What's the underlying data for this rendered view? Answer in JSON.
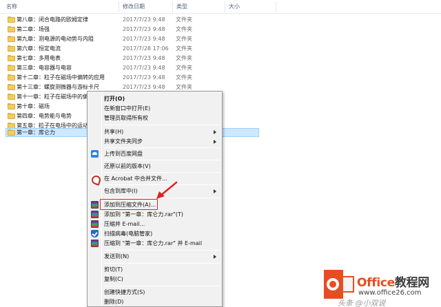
{
  "columns": {
    "name": "名称",
    "date": "修改日期",
    "type": "类型",
    "size": "大小"
  },
  "files": [
    {
      "name": "第八章：闭合电路的欧姆定律",
      "date": "2017/7/23 9:48",
      "type": "文件夹"
    },
    {
      "name": "第二章：场强",
      "date": "2017/7/23 9:48",
      "type": "文件夹"
    },
    {
      "name": "第九章：测电源的电动势与内阻",
      "date": "2017/7/23 9:48",
      "type": "文件夹"
    },
    {
      "name": "第六章：恒定电流",
      "date": "2017/7/28 17:06",
      "type": "文件夹"
    },
    {
      "name": "第七章：多用电表",
      "date": "2017/7/23 9:48",
      "type": "文件夹"
    },
    {
      "name": "第三章：电容器与电容",
      "date": "2017/7/23 9:48",
      "type": "文件夹"
    },
    {
      "name": "第十二章：粒子在磁场中偏转的应用",
      "date": "2017/7/23 9:48",
      "type": "文件夹"
    },
    {
      "name": "第十三章：螺旋测微器与游标卡尺",
      "date": "2017/7/23 9:48",
      "type": "文件夹"
    },
    {
      "name": "第十一章：粒子在磁场中的偏转",
      "date": "",
      "type": ""
    },
    {
      "name": "第十章：磁场",
      "date": "",
      "type": ""
    },
    {
      "name": "第四章：电势能与电势",
      "date": "",
      "type": ""
    },
    {
      "name": "第五章：粒子在电场中的运动",
      "date": "",
      "type": ""
    },
    {
      "name": "第一章：库仑力",
      "date": "",
      "type": ""
    }
  ],
  "menu": {
    "open": "打开(O)",
    "open_new_window": "在新窗口中打开(E)",
    "admin_ownership": "管理员取得所有权",
    "share": "共享(H)",
    "share_sync": "共享文件夹同步",
    "upload_baidu": "上传到百度网盘",
    "restore_previous": "还原以前的版本(V)",
    "acrobat_combine": "在 Acrobat 中合并文件...",
    "include_library": "包含到库中(I)",
    "add_to_archive": "添加到压缩文件(A)...",
    "add_to_rar": "添加到 \"第一章：库仑力.rar\"(T)",
    "compress_email": "压缩并 E-mail...",
    "scan_virus": "扫描病毒(电脑管家)",
    "compress_rar_email": "压缩到 \"第一章：库仑力.rar\" 并 E-mail",
    "send_to": "发送到(N)",
    "cut": "剪切(T)",
    "copy": "复制(C)",
    "create_shortcut": "创建快捷方式(S)",
    "delete": "删除(D)"
  },
  "watermark": {
    "brand_a": "Office",
    "brand_b": "教程网",
    "site": "www.office26.com",
    "credit": "头条 @小双说"
  },
  "colors": {
    "selection": "#cde8ff",
    "highlight": "#e02020",
    "brand": "#e84c22"
  }
}
